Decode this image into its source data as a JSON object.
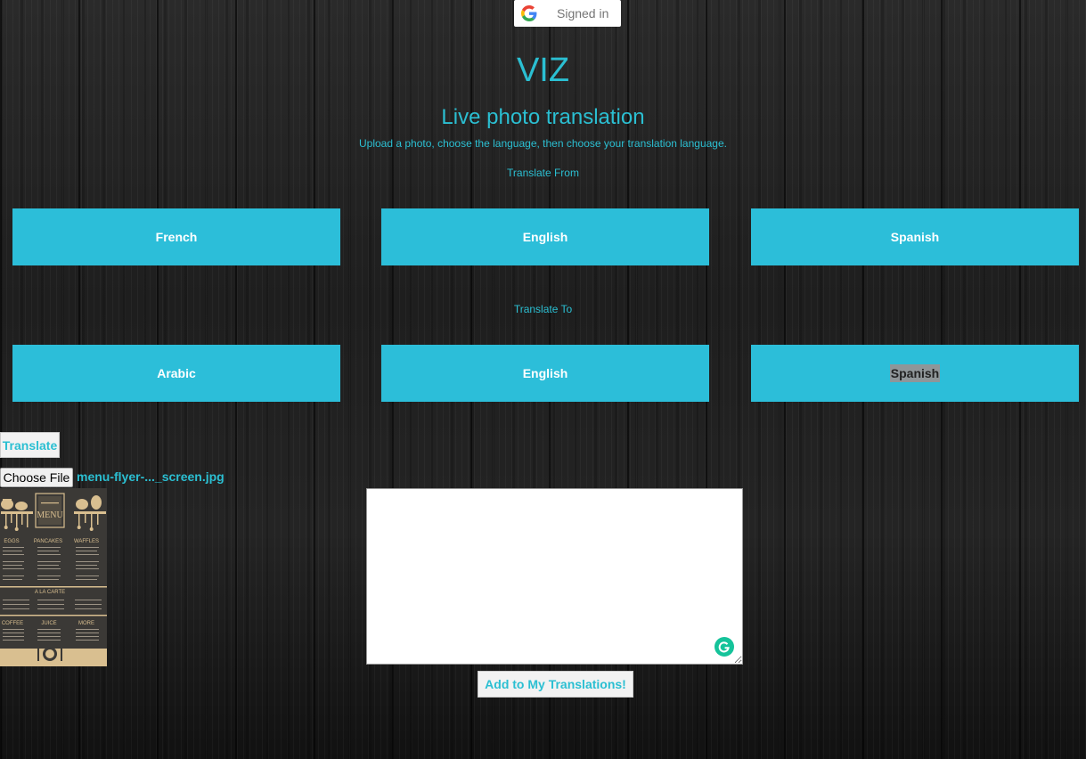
{
  "signin": {
    "label": "Signed in",
    "icon": "google-icon"
  },
  "header": {
    "title": "VIZ",
    "subtitle": "Live photo translation",
    "instructions": "Upload a photo, choose the language, then choose your translation language."
  },
  "translate_from": {
    "label": "Translate From",
    "options": [
      "French",
      "English",
      "Spanish"
    ]
  },
  "translate_to": {
    "label": "Translate To",
    "options": [
      "Arabic",
      "English",
      "Spanish"
    ],
    "selected": "Spanish"
  },
  "actions": {
    "translate_label": "Translate",
    "choose_file_label": "Choose File",
    "file_name": "menu-flyer-..._screen.jpg",
    "add_label": "Add to My Translations!"
  },
  "menu_image": {
    "heading": "MENU",
    "sections": [
      "EGGS",
      "PANCAKES",
      "WAFFLES",
      "A LA CARTE",
      "COFFEE",
      "JUICE",
      "MORE"
    ]
  },
  "output": {
    "value": ""
  },
  "colors": {
    "accent": "#2bbfd2",
    "button_bg": "#2cbed9",
    "grammarly": "#15c39a"
  }
}
